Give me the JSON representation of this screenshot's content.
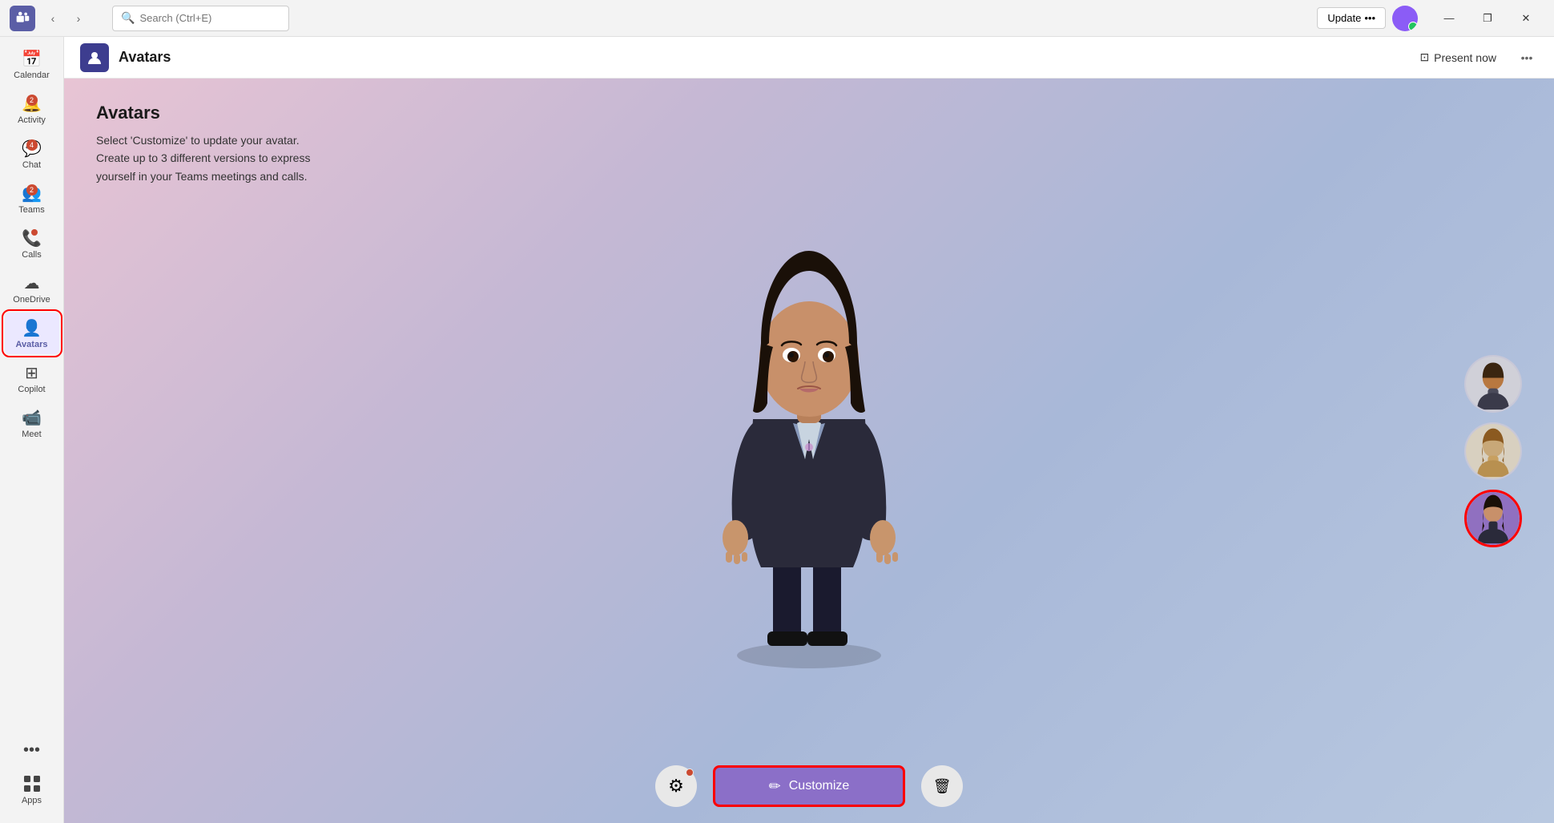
{
  "titlebar": {
    "search_placeholder": "Search (Ctrl+E)",
    "update_label": "Update",
    "update_dots": "•••",
    "window_minimize": "—",
    "window_maximize": "❐",
    "window_close": "✕"
  },
  "sidebar": {
    "items": [
      {
        "id": "calendar",
        "label": "Calendar",
        "icon": "📅",
        "badge": null,
        "dot": false
      },
      {
        "id": "activity",
        "label": "Activity",
        "icon": "🔔",
        "badge": "2",
        "dot": false
      },
      {
        "id": "chat",
        "label": "Chat",
        "icon": "💬",
        "badge": "4",
        "dot": false
      },
      {
        "id": "teams",
        "label": "Teams",
        "icon": "👥",
        "badge": "2",
        "dot": false
      },
      {
        "id": "calls",
        "label": "Calls",
        "icon": "📞",
        "badge": null,
        "dot": true
      },
      {
        "id": "onedrive",
        "label": "OneDrive",
        "icon": "☁",
        "badge": null,
        "dot": false
      },
      {
        "id": "avatars",
        "label": "Avatars",
        "icon": "👤",
        "badge": null,
        "dot": false,
        "active": true
      },
      {
        "id": "copilot",
        "label": "Copilot",
        "icon": "⊞",
        "badge": null,
        "dot": false
      },
      {
        "id": "meet",
        "label": "Meet",
        "icon": "📹",
        "badge": null,
        "dot": false
      }
    ],
    "more_label": "•••",
    "apps_label": "Apps",
    "apps_icon": "⊕"
  },
  "app_header": {
    "title": "Avatars",
    "present_label": "Present now",
    "more_dots": "•••"
  },
  "main": {
    "title": "Avatars",
    "description_line1": "Select 'Customize' to update your avatar.",
    "description_line2": "Create up to 3 different versions to express",
    "description_line3": "yourself in your Teams meetings and calls.",
    "customize_label": "Customize",
    "pencil_icon": "✏",
    "trash_icon": "🗑",
    "gear_icon": "⚙"
  },
  "colors": {
    "accent": "#5b5ea6",
    "active_bg": "#ebe8ff",
    "badge_bg": "#cc4a31",
    "customize_btn": "#8b6fc8",
    "selected_outline": "#ff0000"
  }
}
